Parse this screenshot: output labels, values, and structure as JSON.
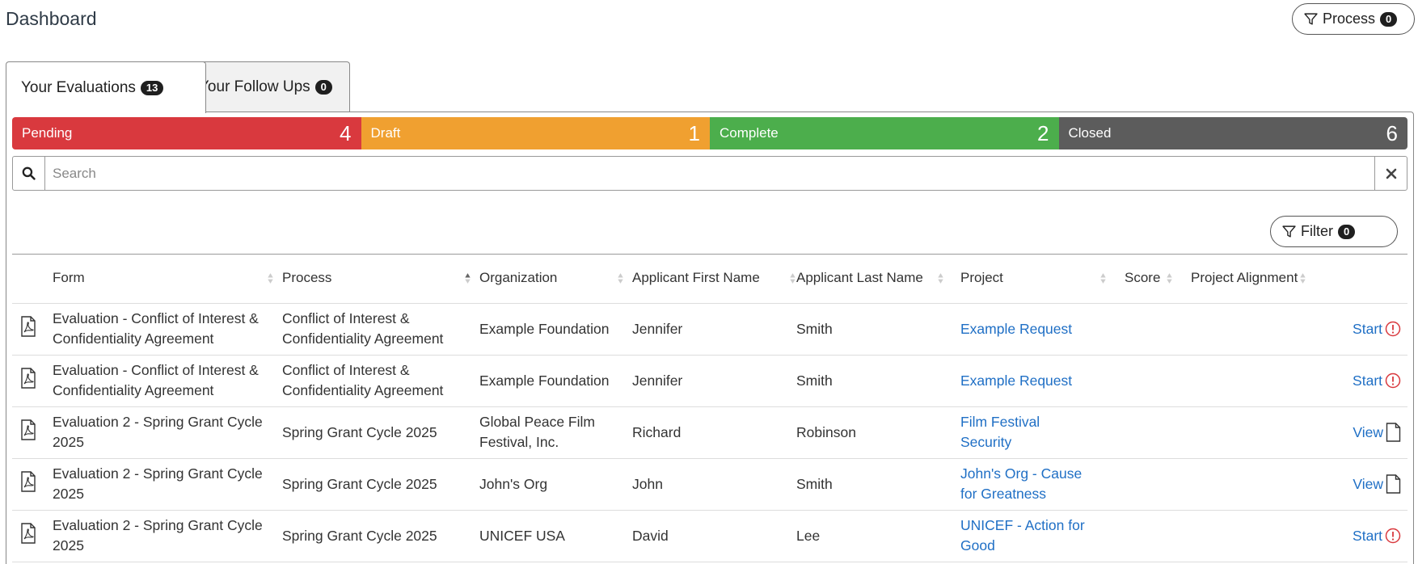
{
  "page": {
    "title": "Dashboard"
  },
  "process_button": {
    "label": "Process",
    "count": "0"
  },
  "tabs": [
    {
      "label": "Your Evaluations",
      "count": "13"
    },
    {
      "label": "Your Follow Ups",
      "count": "0"
    }
  ],
  "status_segments": [
    {
      "label": "Pending",
      "count": "4",
      "color": "#d9393e"
    },
    {
      "label": "Draft",
      "count": "1",
      "color": "#f0a030"
    },
    {
      "label": "Complete",
      "count": "2",
      "color": "#4cae4c"
    },
    {
      "label": "Closed",
      "count": "6",
      "color": "#5c5c5c"
    }
  ],
  "search": {
    "placeholder": "Search",
    "value": ""
  },
  "filter_button": {
    "label": "Filter",
    "count": "0"
  },
  "table": {
    "columns": [
      "Form",
      "Process",
      "Organization",
      "Applicant First Name",
      "Applicant Last Name",
      "Project",
      "Score",
      "Project Alignment"
    ],
    "rows": [
      {
        "form": "Evaluation - Conflict of Interest & Confidentiality Agreement",
        "process": "Conflict of Interest & Confidentiality Agreement",
        "organization": "Example Foundation",
        "first_name": "Jennifer",
        "last_name": "Smith",
        "project": "Example Request",
        "score": "",
        "alignment": "",
        "action": "Start",
        "action_icon": "alert-circle-icon"
      },
      {
        "form": "Evaluation - Conflict of Interest & Confidentiality Agreement",
        "process": "Conflict of Interest & Confidentiality Agreement",
        "organization": "Example Foundation",
        "first_name": "Jennifer",
        "last_name": "Smith",
        "project": "Example Request",
        "score": "",
        "alignment": "",
        "action": "Start",
        "action_icon": "alert-circle-icon"
      },
      {
        "form": "Evaluation 2 - Spring Grant Cycle 2025",
        "process": "Spring Grant Cycle 2025",
        "organization": "Global Peace Film Festival, Inc.",
        "first_name": "Richard",
        "last_name": "Robinson",
        "project": "Film Festival Security",
        "score": "",
        "alignment": "",
        "action": "View",
        "action_icon": "document-icon"
      },
      {
        "form": "Evaluation 2 - Spring Grant Cycle 2025",
        "process": "Spring Grant Cycle 2025",
        "organization": "John's Org",
        "first_name": "John",
        "last_name": "Smith",
        "project": "John's Org - Cause for Greatness",
        "score": "",
        "alignment": "",
        "action": "View",
        "action_icon": "document-icon"
      },
      {
        "form": "Evaluation 2 - Spring Grant Cycle 2025",
        "process": "Spring Grant Cycle 2025",
        "organization": "UNICEF USA",
        "first_name": "David",
        "last_name": "Lee",
        "project": "UNICEF - Action for Good",
        "score": "",
        "alignment": "",
        "action": "Start",
        "action_icon": "alert-circle-icon"
      }
    ]
  },
  "colors": {
    "link": "#1f6fc5",
    "alert": "#d9393e"
  }
}
